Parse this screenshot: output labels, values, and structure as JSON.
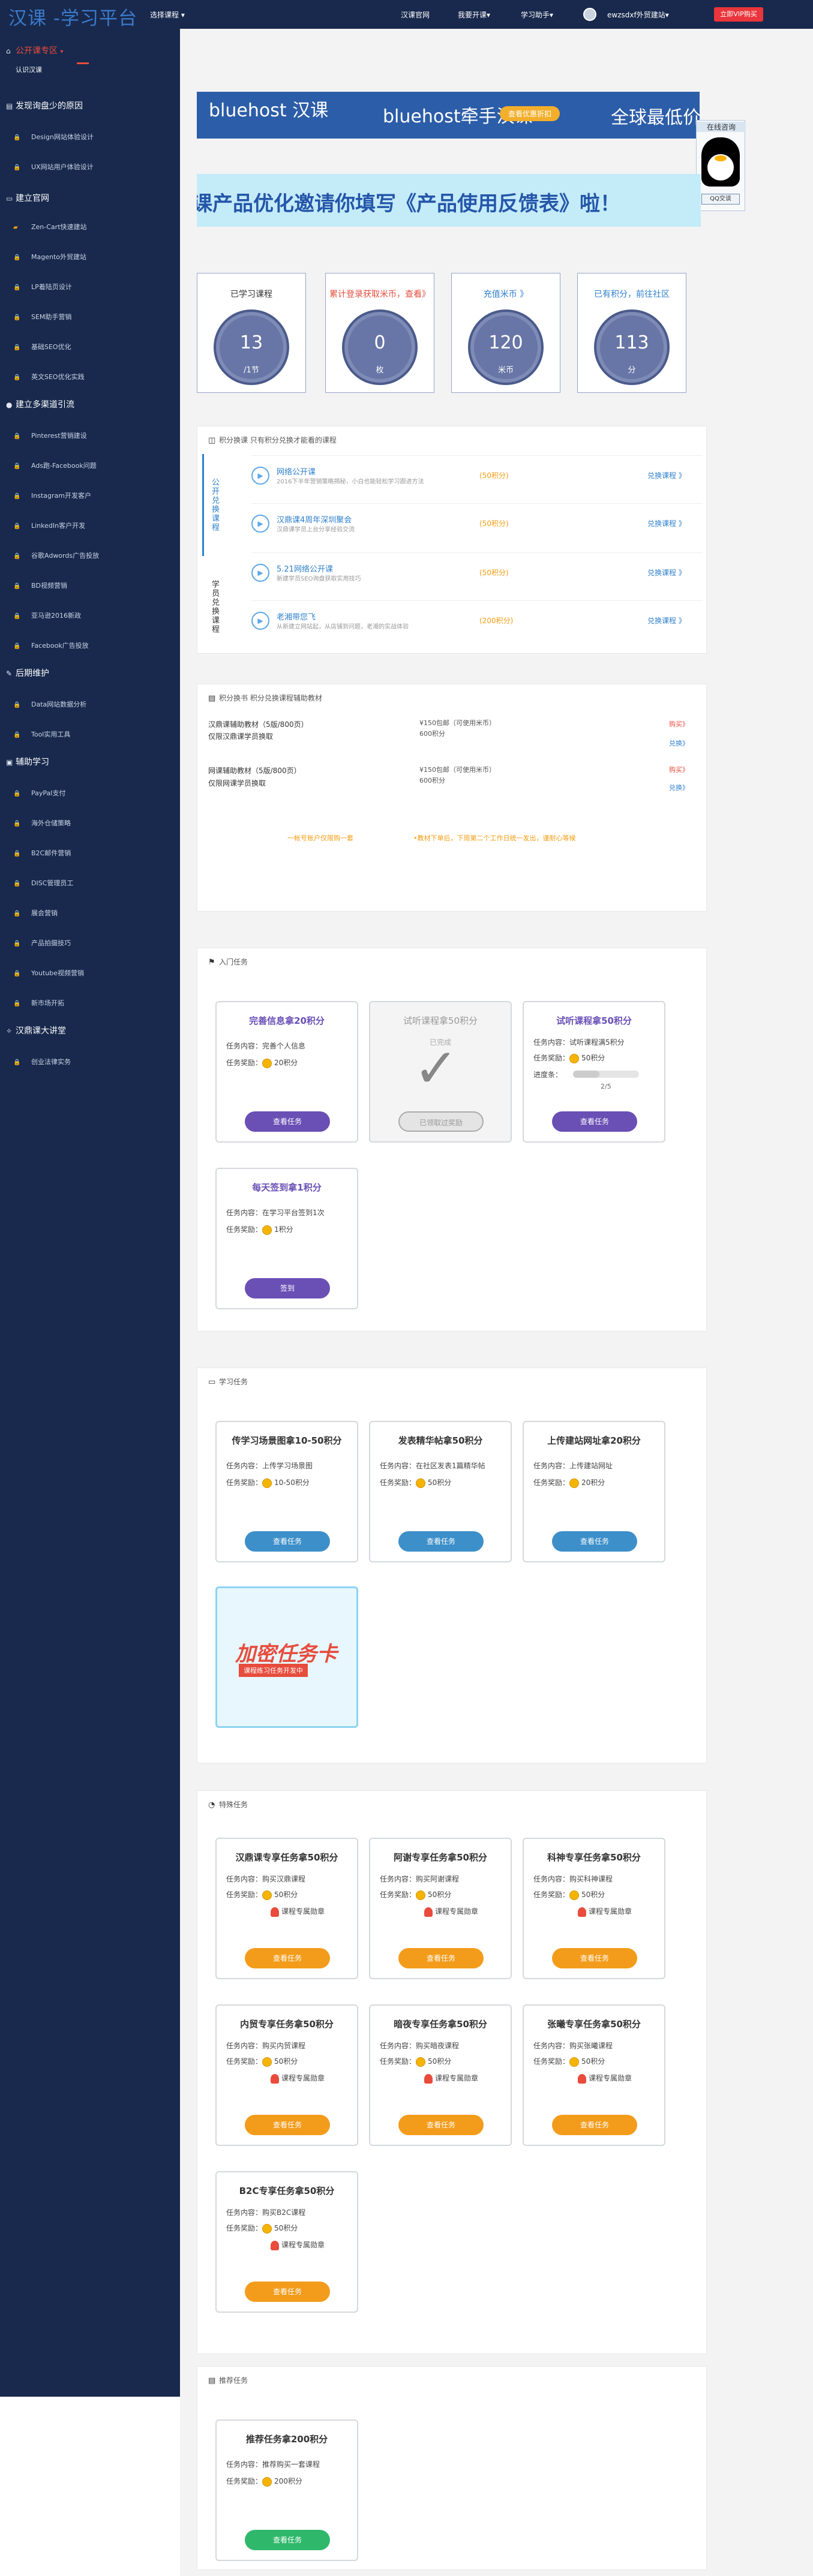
{
  "header": {
    "logo": "汉课 -学习平台",
    "select_course": "选择课程 ▾",
    "nav": [
      "汉课官网",
      "我要开课▾",
      "学习助手▾"
    ],
    "user": "ewzsdxf外贸建站▾",
    "vip_button": "立即VIP购买"
  },
  "sidebar": {
    "sections": [
      {
        "title": "公开课专区",
        "items": [
          "认识汉课"
        ]
      },
      {
        "title": "发现询盘少的原因",
        "items": [
          "Design网站体验设计",
          "UX网站用户体验设计"
        ]
      },
      {
        "title": "建立官网",
        "items": [
          "Zen-Cart快速建站",
          "Magento外贸建站",
          "LP着陆页设计",
          "SEM助手营销",
          "基础SEO优化",
          "英文SEO优化实践"
        ]
      },
      {
        "title": "建立多渠道引流",
        "items": [
          "Pinterest营销建设",
          "Ads跑-Facebook问题",
          "Instagram开发客户",
          "LinkedIn客户开发",
          "谷歌Adwords广告投放",
          "BD视频营销",
          "亚马逊2016新政",
          "Facebook广告投放"
        ]
      },
      {
        "title": "后期维护",
        "items": [
          "Data网站数据分析",
          "Tool实用工具"
        ]
      },
      {
        "title": "辅助学习",
        "items": [
          "PayPal支付",
          "海外仓储策略",
          "B2C邮件营销",
          "DISC管理员工",
          "展会营销",
          "产品拍摄技巧",
          "Youtube视频营销",
          "新市场开拓"
        ]
      },
      {
        "title": "汉鼎课大讲堂",
        "items": [
          "创业法律实务"
        ]
      }
    ]
  },
  "banner": {
    "brand": "bluehost",
    "brand_suffix": "汉课",
    "tagline": "bluehost牵手汉课",
    "price": "全球最低价",
    "button": "查看优惠折扣"
  },
  "qq": {
    "title": "在线咨询",
    "button": "QQ交谈"
  },
  "feedback": "课产品优化邀请你填写《产品使用反馈表》啦！",
  "stats": [
    {
      "label": "已学习课程",
      "value": "13",
      "unit": "/1节",
      "color": "#333333"
    },
    {
      "label": "累计登录获取米币，查看》",
      "value": "0",
      "unit": "枚",
      "color": "#e74c3c"
    },
    {
      "label": "充值米币 》",
      "value": "120",
      "unit": "米币",
      "color": "#2e7fcc"
    },
    {
      "label": "已有积分，前往社区",
      "value": "113",
      "unit": "分",
      "color": "#333333"
    }
  ],
  "exchange": {
    "title": "积分换课 只有积分兑换才能看的课程",
    "tabs": [
      "公开兑换课程",
      "学员兑换课程"
    ],
    "rows": [
      {
        "name": "网络公开课",
        "desc": "2016下半年营销策略揭秘，小白也能轻松学习跟进方法",
        "points": "(50积分)",
        "button": "兑换课程 》"
      },
      {
        "name": "汉鼎课4周年深圳聚会",
        "desc": "汉鼎课学员上台分享经验交流",
        "points": "(50积分)",
        "button": "兑换课程 》"
      },
      {
        "name": "5.21网络公开课",
        "desc": "新建学员SEO询盘获取实用技巧",
        "points": "(50积分)",
        "button": "兑换课程 》"
      },
      {
        "name": "老湘带您飞",
        "desc": "从新建立网站起，从店铺到问题，老湘的实战体验",
        "points": "(200积分)",
        "button": "兑换课程 》"
      }
    ]
  },
  "materials": {
    "title": "积分换书 积分兑换课程辅助教材",
    "rows": [
      {
        "name": "汉鼎课辅助教材（5版/800页）",
        "sub": "仅限汉鼎课学员换取",
        "price": "¥150包邮（可使用米币）",
        "points": "600积分",
        "actions": [
          "购买》",
          "兑换》"
        ]
      },
      {
        "name": "网课辅助教材（5版/800页）",
        "sub": "仅限网课学员换取",
        "price": "¥150包邮（可使用米币）",
        "points": "600积分",
        "actions": [
          "购买》",
          "兑换》"
        ]
      }
    ],
    "note_left": "一帐号账户仅限购一套",
    "note_right": "•教材下单后，下周第二个工作日统一发出，谨耐心等候"
  },
  "beginner": {
    "title": "入门任务",
    "cards": [
      {
        "title": "完善信息拿20积分",
        "content": "任务内容：完善个人信息",
        "reward": "任务奖励：",
        "reward_val": "20积分",
        "button": "查看任务",
        "color": "#6a4fb5"
      },
      {
        "title": "试听课程拿50积分",
        "content": "已完成",
        "reward": "",
        "reward_val": "",
        "button": "已领取过奖励",
        "color": "#cccccc"
      },
      {
        "title": "试听课程拿50积分",
        "content": "任务内容：试听课程满5积分",
        "reward": "任务奖励：",
        "reward_val": "50积分",
        "progress_label": "进度条：",
        "progress_text": "2/5",
        "progress": 0.4,
        "button": "查看任务",
        "color": "#6a4fb5"
      },
      {
        "title": "每天签到拿1积分",
        "content": "任务内容：在学习平台签到1次",
        "reward": "任务奖励：",
        "reward_val": "1积分",
        "button": "签到",
        "color": "#6a4fb5"
      }
    ]
  },
  "learning": {
    "title": "学习任务",
    "cards": [
      {
        "title": "传学习场景图拿10-50积分",
        "content": "任务内容：上传学习场景图",
        "reward": "任务奖励：",
        "reward_val": "10-50积分",
        "button": "查看任务"
      },
      {
        "title": "发表精华帖拿50积分",
        "content": "任务内容：在社区发表1篇精华帖",
        "reward": "任务奖励：",
        "reward_val": "50积分",
        "button": "查看任务"
      },
      {
        "title": "上传建站网址拿20积分",
        "content": "任务内容：上传建站网址",
        "reward": "任务奖励：",
        "reward_val": "20积分",
        "button": "查看任务"
      }
    ],
    "promo": {
      "title": "加密任务卡",
      "sub": "课程练习任务开发中"
    }
  },
  "special": {
    "title": "特殊任务",
    "cards": [
      {
        "title": "汉鼎课专享任务拿50积分",
        "content": "任务内容：购买汉鼎课程",
        "reward_val": "50积分",
        "medal": "课程专属勋章",
        "button": "查看任务"
      },
      {
        "title": "阿谢专享任务拿50积分",
        "content": "任务内容：购买阿谢课程",
        "reward_val": "50积分",
        "medal": "课程专属勋章",
        "button": "查看任务"
      },
      {
        "title": "科神专享任务拿50积分",
        "content": "任务内容：购买科神课程",
        "reward_val": "50积分",
        "medal": "课程专属勋章",
        "button": "查看任务"
      },
      {
        "title": "内贸专享任务拿50积分",
        "content": "任务内容：购买内贸课程",
        "reward_val": "50积分",
        "medal": "课程专属勋章",
        "button": "查看任务"
      },
      {
        "title": "暗夜专享任务拿50积分",
        "content": "任务内容：购买暗夜课程",
        "reward_val": "50积分",
        "medal": "课程专属勋章",
        "button": "查看任务"
      },
      {
        "title": "张曦专享任务拿50积分",
        "content": "任务内容：购买张曦课程",
        "reward_val": "50积分",
        "medal": "课程专属勋章",
        "button": "查看任务"
      },
      {
        "title": "B2C专享任务拿50积分",
        "content": "任务内容：购买B2C课程",
        "reward_val": "50积分",
        "medal": "课程专属勋章",
        "button": "查看任务"
      }
    ],
    "reward_label": "任务奖励："
  },
  "recommend": {
    "title": "推荐任务",
    "card": {
      "title": "推荐任务拿200积分",
      "content": "任务内容：推荐购买一套课程",
      "reward": "任务奖励：",
      "reward_val": "200积分",
      "button": "查看任务"
    }
  }
}
